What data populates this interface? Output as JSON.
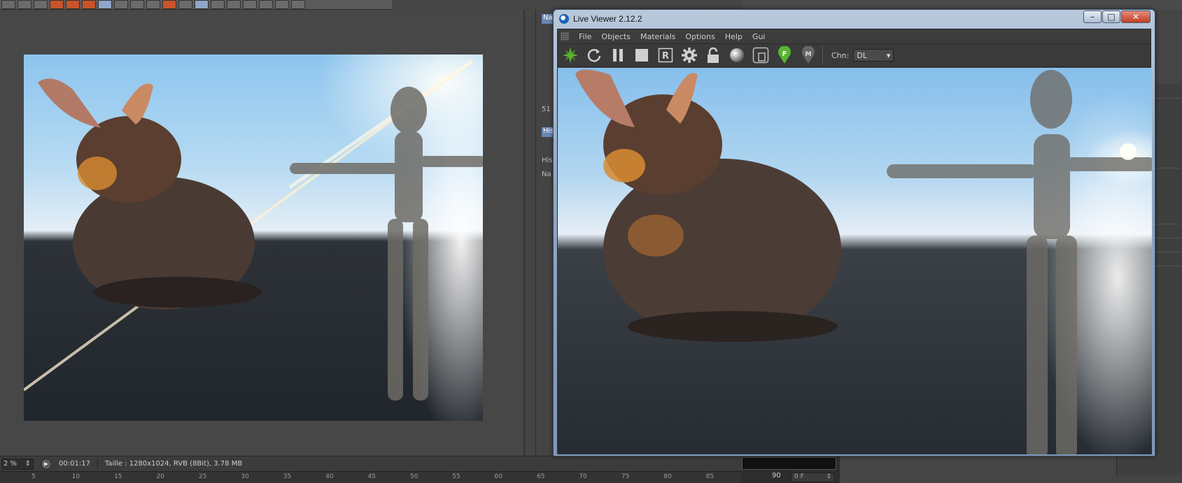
{
  "live_viewer": {
    "title": "Live Viewer 2.12.2",
    "menu": [
      "File",
      "Objects",
      "Materials",
      "Options",
      "Help",
      "Gui"
    ],
    "toolbar": {
      "icons": [
        "octane-logo-icon",
        "restart-icon",
        "pause-icon",
        "stop-icon",
        "region-render-icon",
        "settings-gear-icon",
        "lock-icon",
        "sphere-material-icon",
        "focus-frame-icon",
        "focus-picker-icon",
        "material-picker-icon"
      ],
      "focus_badge": "F",
      "channel_label": "Chn:",
      "channel_value": "DL"
    },
    "window_controls": {
      "minimize": "–",
      "maximize": "□",
      "close": "✕"
    }
  },
  "host": {
    "mid_panel": {
      "tab1": "Na",
      "value1": "51",
      "tab2": "His",
      "label_hi": "His",
      "label_na": "Na"
    },
    "status": {
      "zoom": "2 %",
      "elapsed": "00:01:17",
      "image_info": "Taille : 1280x1024, RVB (8Bit), 3.78 MB"
    },
    "timeline": {
      "ticks": [
        "5",
        "10",
        "15",
        "20",
        "25",
        "30",
        "35",
        "40",
        "45",
        "50",
        "55",
        "60",
        "65",
        "70",
        "75",
        "80",
        "85"
      ],
      "end_frame": "90",
      "frame_field": "0 F"
    }
  },
  "colors": {
    "octane_green": "#58b62c",
    "window_frame": "#8fa8c4",
    "close_red": "#c33d24",
    "toolbar_orange": "#c8542a"
  }
}
